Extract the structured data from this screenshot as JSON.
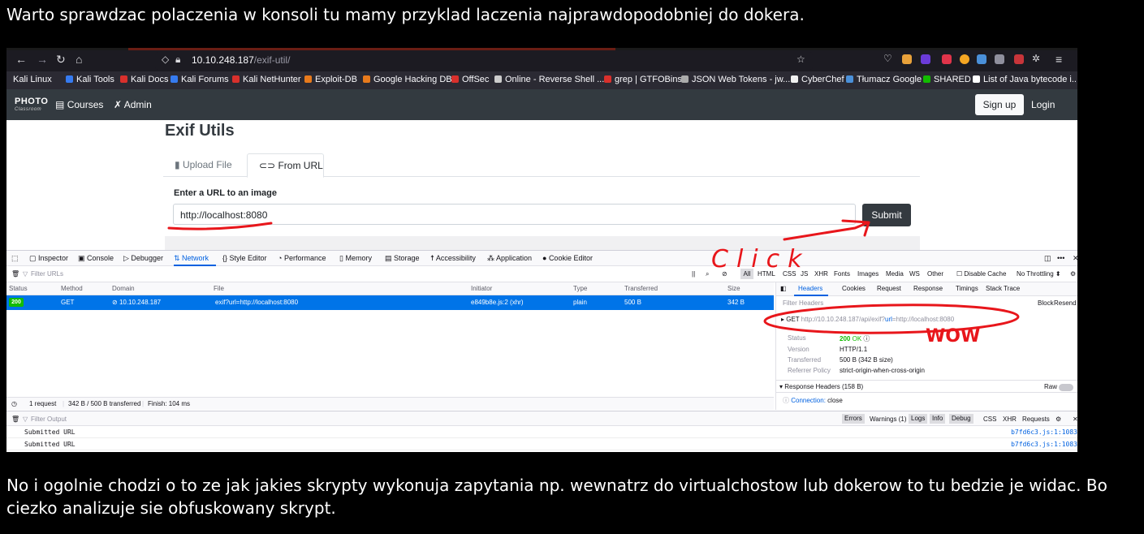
{
  "caption_top": "Warto sprawdzac polaczenia w konsoli tu mamy przyklad laczenia najprawdopodobniej do dokera.",
  "caption_bottom": "No i ogolnie chodzi o to ze jak jakies skrypty wykonuja zapytania np. wewnatrz do virtualchostow lub dokerow to tu bedzie je widac. Bo ciezko analizuje sie obfuskowany skrypt.",
  "browser": {
    "url_host": "10.10.248.187",
    "url_path": "/exif-util/",
    "nav_icons": [
      "back-arrow-icon",
      "forward-arrow-icon",
      "reload-icon",
      "home-icon"
    ],
    "bookmarks": [
      "Kali Linux",
      "Kali Tools",
      "Kali Docs",
      "Kali Forums",
      "Kali NetHunter",
      "Exploit-DB",
      "Google Hacking DB",
      "OffSec",
      "Online - Reverse Shell ...",
      "grep | GTFOBins",
      "JSON Web Tokens - jw...",
      "CyberChef",
      "Tłumacz Google",
      "SHARED",
      "List of Java bytecode i..."
    ]
  },
  "site": {
    "logo": "PHOTO",
    "logo_sub": "Classroom",
    "nav_courses": "Courses",
    "nav_admin": "Admin",
    "signup": "Sign up",
    "login": "Login",
    "title": "Exif Utils",
    "tab_upload": "Upload File",
    "tab_url": "From URL",
    "field_label": "Enter a URL to an image",
    "field_value": "http://localhost:8080",
    "submit": "Submit"
  },
  "devtools": {
    "tabs": [
      "Inspector",
      "Console",
      "Debugger",
      "Network",
      "Style Editor",
      "Performance",
      "Memory",
      "Storage",
      "Accessibility",
      "Application",
      "Cookie Editor"
    ],
    "filter_placeholder": "Filter URLs",
    "type_filters": [
      "All",
      "HTML",
      "CSS",
      "JS",
      "XHR",
      "Fonts",
      "Images",
      "Media",
      "WS",
      "Other"
    ],
    "disable_cache": "Disable Cache",
    "throttling": "No Throttling",
    "columns": [
      "Status",
      "Method",
      "Domain",
      "File",
      "Initiator",
      "Type",
      "Transferred",
      "Size"
    ],
    "row": {
      "status": "200",
      "method": "GET",
      "domain": "10.10.248.187",
      "file": "exif?url=http://localhost:8080",
      "initiator": "e849b8e.js:2 (xhr)",
      "type": "plain",
      "transferred": "500 B",
      "size": "342 B"
    },
    "footer": {
      "requests": "1 request",
      "transferred": "342 B / 500 B transferred",
      "finish": "Finish: 104 ms"
    },
    "side_tabs": [
      "Headers",
      "Cookies",
      "Request",
      "Response",
      "Timings",
      "Stack Trace"
    ],
    "side_filter": "Filter Headers",
    "side_block": "Block",
    "side_resend": "Resend",
    "request_line": {
      "method": "GET",
      "base": "http://10.10.248.187/api/exif?",
      "param": "url",
      "rest": "=http://localhost:8080"
    },
    "details": {
      "status_label": "Status",
      "status_code": "200",
      "status_text": "OK",
      "version_label": "Version",
      "version": "HTTP/1.1",
      "transferred_label": "Transferred",
      "transferred": "500 B (342 B size)",
      "referrer_label": "Referrer Policy",
      "referrer": "strict-origin-when-cross-origin"
    },
    "response_headers": "Response Headers (158 B)",
    "raw": "Raw",
    "connection_label": "Connection:",
    "connection_value": "close"
  },
  "console": {
    "filter_placeholder": "Filter Output",
    "levels": [
      "Errors",
      "Warnings (1)",
      "Logs",
      "Info",
      "Debug"
    ],
    "extras": [
      "CSS",
      "XHR",
      "Requests"
    ],
    "logs": [
      {
        "msg": "Submitted URL",
        "src": "b7fd6c3.js:1:1083"
      },
      {
        "msg": "Submitted URL",
        "src": "b7fd6c3.js:1:1083"
      }
    ]
  },
  "annotations": {
    "click_text": "Click",
    "wow_text": "WOW",
    "color": "#e8161b"
  }
}
